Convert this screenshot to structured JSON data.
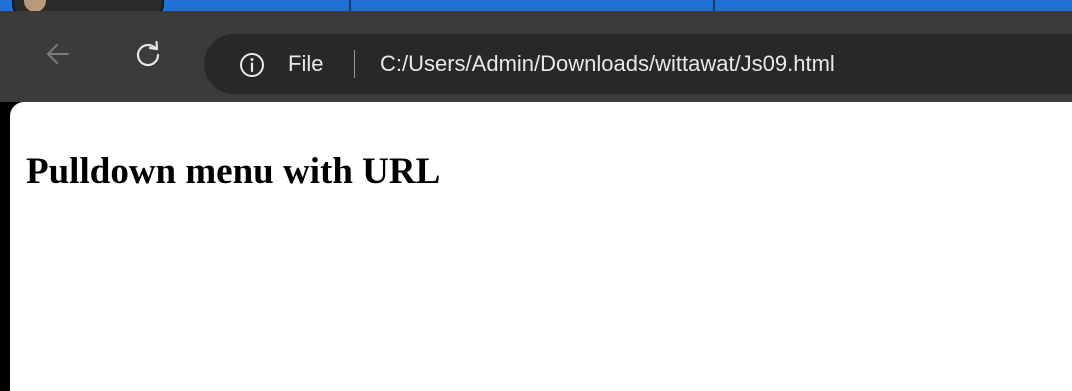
{
  "toolbar": {
    "scheme_label": "File",
    "url": "C:/Users/Admin/Downloads/wittawat/Js09.html"
  },
  "page": {
    "heading": "Pulldown menu with URL"
  },
  "icons": {
    "back": "back-arrow-icon",
    "reload": "reload-icon",
    "site_info": "info-icon"
  },
  "colors": {
    "tab_strip": "#1f6fd6",
    "toolbar": "#3b3b3b",
    "omnibox": "#282828",
    "page_background": "#ffffff"
  }
}
